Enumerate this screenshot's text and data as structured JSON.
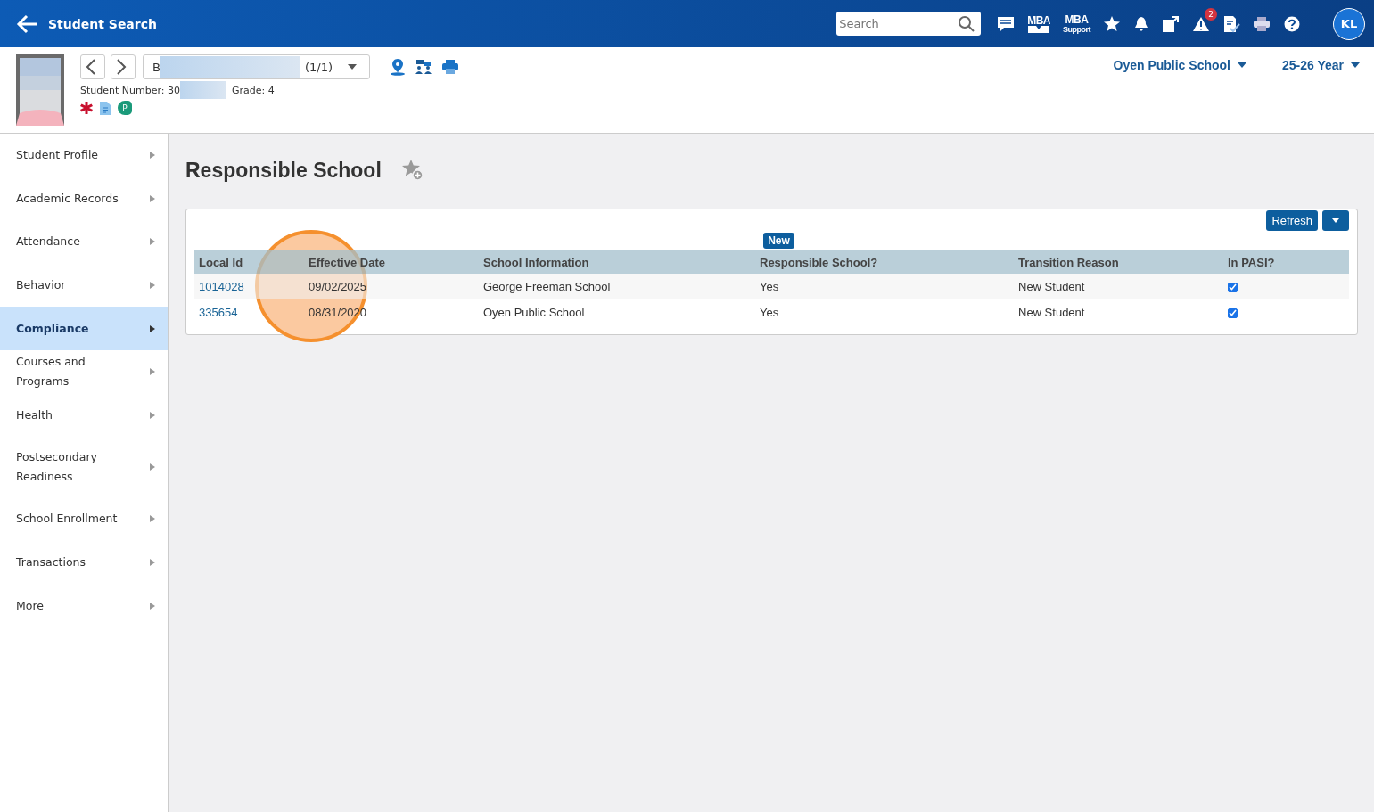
{
  "top_bar": {
    "back_label": "Student Search",
    "search": {
      "placeholder": "Search"
    },
    "alert_count": "2",
    "mba_label": "MBA",
    "mba_support_label": "MBA",
    "mba_support_sub": "Support",
    "avatar": "KL"
  },
  "student": {
    "name": "B",
    "counter": "(1/1)",
    "number_label": "Student Number: 30",
    "grade_label": "Grade: 4",
    "flag_letter": "P"
  },
  "context": {
    "school": "Oyen Public School",
    "year": "25-26 Year"
  },
  "sidebar": {
    "items": [
      {
        "label": "Student Profile",
        "selected": false
      },
      {
        "label": "Academic Records",
        "selected": false
      },
      {
        "label": "Attendance",
        "selected": false
      },
      {
        "label": "Behavior",
        "selected": false
      },
      {
        "label": "Compliance",
        "selected": true
      },
      {
        "label": "Courses and Programs",
        "selected": false
      },
      {
        "label": "Health",
        "selected": false
      },
      {
        "label": "Postsecondary Readiness",
        "selected": false
      },
      {
        "label": "School Enrollment",
        "selected": false
      },
      {
        "label": "Transactions",
        "selected": false
      },
      {
        "label": "More",
        "selected": false
      }
    ]
  },
  "page": {
    "title": "Responsible School"
  },
  "panel": {
    "refresh_label": "Refresh",
    "new_label": "New",
    "table": {
      "columns": [
        "Local Id",
        "Effective Date",
        "School Information",
        "Responsible School?",
        "Transition Reason",
        "In PASI?"
      ],
      "rows": [
        {
          "local_id": "1014028",
          "effective_date": "09/02/2025",
          "school": "George Freeman School",
          "responsible": "Yes",
          "reason": "New Student",
          "in_pasi": true
        },
        {
          "local_id": "335654",
          "effective_date": "08/31/2020",
          "school": "Oyen Public School",
          "responsible": "Yes",
          "reason": "New Student",
          "in_pasi": true
        }
      ]
    }
  }
}
